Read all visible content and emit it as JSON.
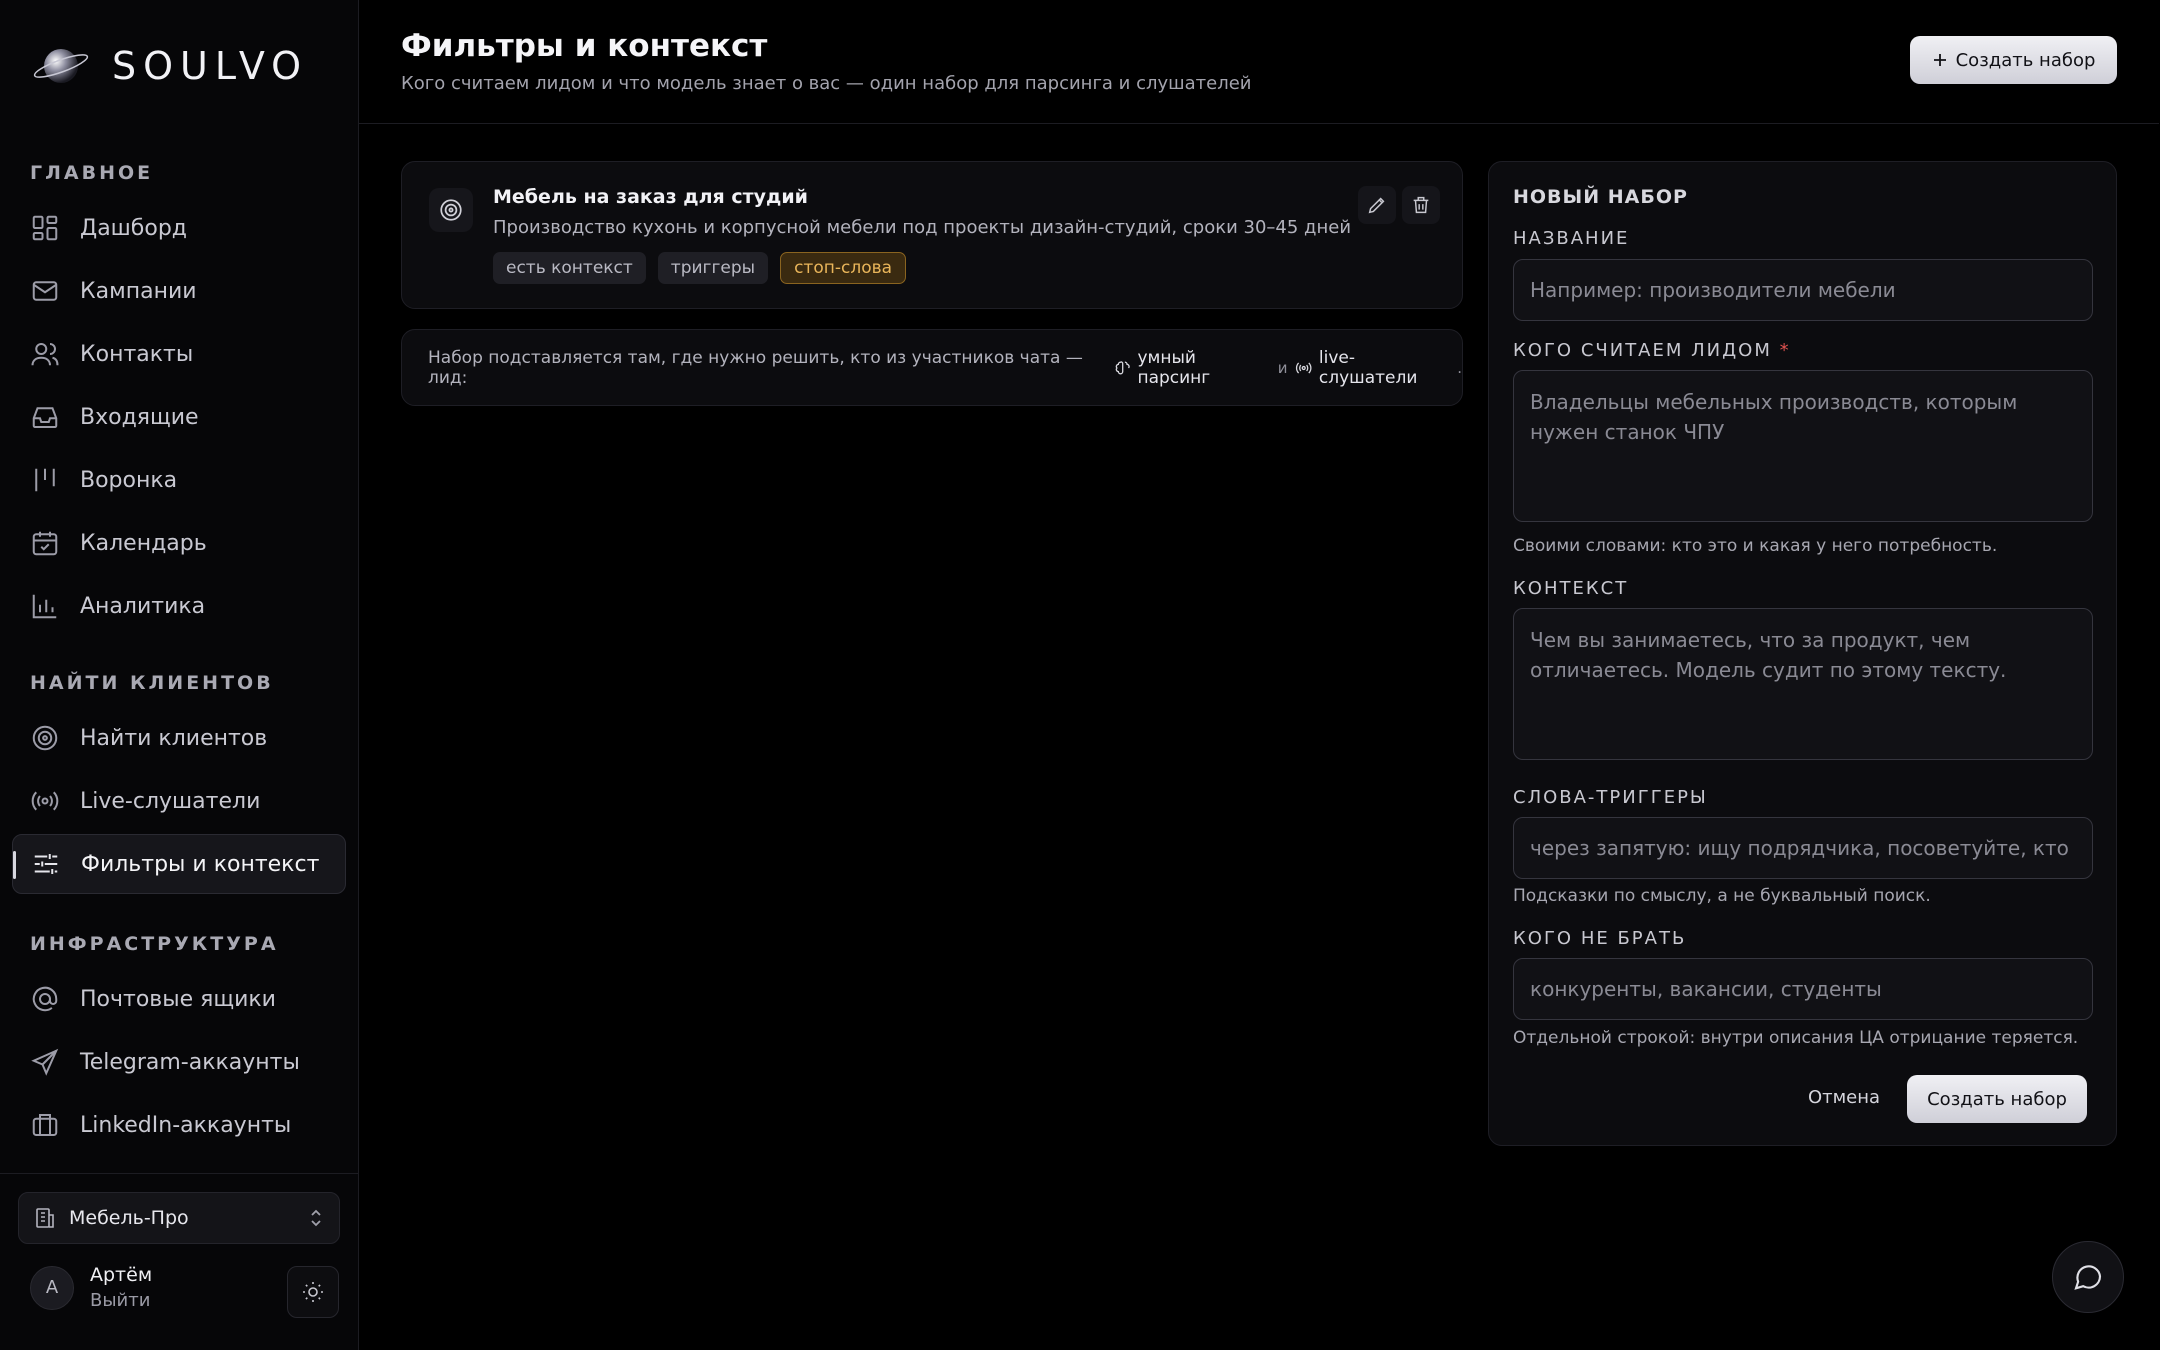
{
  "brand": {
    "name": "SOULVO"
  },
  "sidebar": {
    "sections": [
      {
        "title": "ГЛАВНОЕ"
      },
      {
        "title": "НАЙТИ КЛИЕНТОВ"
      },
      {
        "title": "ИНФРАСТРУКТУРА"
      }
    ],
    "items": [
      {
        "label": "Дашборд",
        "icon": "dashboard-icon"
      },
      {
        "label": "Кампании",
        "icon": "mail-icon"
      },
      {
        "label": "Контакты",
        "icon": "users-icon"
      },
      {
        "label": "Входящие",
        "icon": "inbox-icon"
      },
      {
        "label": "Воронка",
        "icon": "funnel-icon"
      },
      {
        "label": "Календарь",
        "icon": "calendar-icon"
      },
      {
        "label": "Аналитика",
        "icon": "chart-icon"
      },
      {
        "label": "Найти клиентов",
        "icon": "target-icon"
      },
      {
        "label": "Live-слушатели",
        "icon": "broadcast-icon"
      },
      {
        "label": "Фильтры и контекст",
        "icon": "sliders-icon",
        "active": true
      },
      {
        "label": "Почтовые ящики",
        "icon": "at-icon"
      },
      {
        "label": "Telegram-аккаунты",
        "icon": "send-icon"
      },
      {
        "label": "LinkedIn-аккаунты",
        "icon": "briefcase-icon"
      }
    ],
    "workspace": "Мебель-Про",
    "user": {
      "initial": "А",
      "name": "Артём",
      "logout": "Выйти"
    }
  },
  "header": {
    "title": "Фильтры и контекст",
    "subtitle": "Кого считаем лидом и что модель знает о вас — один набор для парсинга и слушателей",
    "create_button": "Создать набор"
  },
  "set_card": {
    "name": "Мебель на заказ для студий",
    "description": "Производство кухонь и корпусной мебели под проекты дизайн-студий, сроки 30–45 дней",
    "tags": [
      "есть контекст",
      "триггеры",
      "стоп-слова"
    ]
  },
  "info": {
    "text": "Набор подставляется там, где нужно решить, кто из участников чата — лид:",
    "chip1": "умный парсинг",
    "and": "и",
    "chip2": "live-слушатели",
    "end": "."
  },
  "form": {
    "title": "НОВЫЙ НАБОР",
    "name_label": "НАЗВАНИЕ",
    "name_placeholder": "Например: производители мебели",
    "lead_label": "КОГО СЧИТАЕМ ЛИДОМ",
    "required_mark": "*",
    "lead_placeholder": "Владельцы мебельных производств, которым нужен станок ЧПУ",
    "lead_hint": "Своими словами: кто это и какая у него потребность.",
    "context_label": "КОНТЕКСТ",
    "context_placeholder": "Чем вы занимаетесь, что за продукт, чем отличаетесь. Модель судит по этому тексту.",
    "triggers_label": "СЛОВА-ТРИГГЕРЫ",
    "triggers_placeholder": "через запятую: ищу подрядчика, посоветуйте, кто делает",
    "triggers_hint": "Подсказки по смыслу, а не буквальный поиск.",
    "exclude_label": "КОГО НЕ БРАТЬ",
    "exclude_placeholder": "конкуренты, вакансии, студенты",
    "exclude_hint": "Отдельной строкой: внутри описания ЦА отрицание теряется.",
    "cancel": "Отмена",
    "submit": "Создать набор"
  },
  "colors": {
    "background": "#000000",
    "panel": "#0c0c0f",
    "accent_warn": "#e9b55a",
    "required": "#e0524f"
  }
}
